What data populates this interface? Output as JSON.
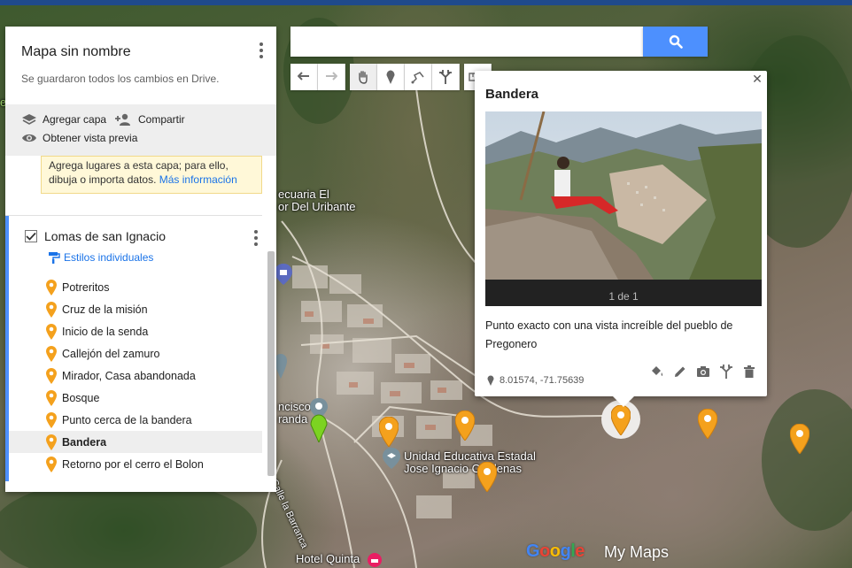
{
  "search": {
    "placeholder": "",
    "value": ""
  },
  "toolbar": {
    "undo_icon": "undo-icon",
    "redo_icon": "redo-icon",
    "pan_icon": "hand-icon",
    "marker_icon": "marker-icon",
    "line_icon": "draw-line-icon",
    "directions_icon": "directions-icon",
    "measure_icon": "ruler-icon"
  },
  "panel": {
    "title": "Mapa sin nombre",
    "save_status": "Se guardaron todos los cambios en Drive.",
    "add_layer_label": "Agregar capa",
    "share_label": "Compartir",
    "preview_label": "Obtener vista previa",
    "notice_text": "Agrega lugares a esta capa; para ello, dibuja o importa datos.",
    "notice_link": "Más información",
    "layer": {
      "name": "Lomas de san Ignacio",
      "checked": true,
      "styles_link": "Estilos individuales",
      "places": [
        {
          "label": "Potreritos"
        },
        {
          "label": "Cruz de la misión"
        },
        {
          "label": "Inicio de la senda"
        },
        {
          "label": "Callejón del zamuro"
        },
        {
          "label": "Mirador, Casa abandonada"
        },
        {
          "label": "Bosque"
        },
        {
          "label": "Punto cerca de la bandera"
        },
        {
          "label": "Bandera",
          "selected": true
        },
        {
          "label": "Retorno por el cerro el Bolon"
        }
      ]
    }
  },
  "popup": {
    "title": "Bandera",
    "photo_counter": "1 de 1",
    "description": "Punto exacto con una vista increíble del pueblo de Pregonero",
    "coordinates": "8.01574, -71.75639"
  },
  "map": {
    "labels": {
      "l1": "ecuaria El",
      "l2": "or Del Uribante",
      "l3": "ncisco",
      "l4": "randa",
      "l5": "Unidad Educativa Estadal",
      "l6": "Jose Ignacio Cardenas",
      "l7": "Calle la Barranca",
      "l8": "Hotel Quinta",
      "l9": "e"
    },
    "brand": {
      "google": [
        "G",
        "o",
        "o",
        "g",
        "l",
        "e"
      ],
      "product": "My Maps"
    }
  },
  "colors": {
    "accent": "#4d90fe",
    "marker": "#f4a11d",
    "link": "#1a73e8"
  }
}
